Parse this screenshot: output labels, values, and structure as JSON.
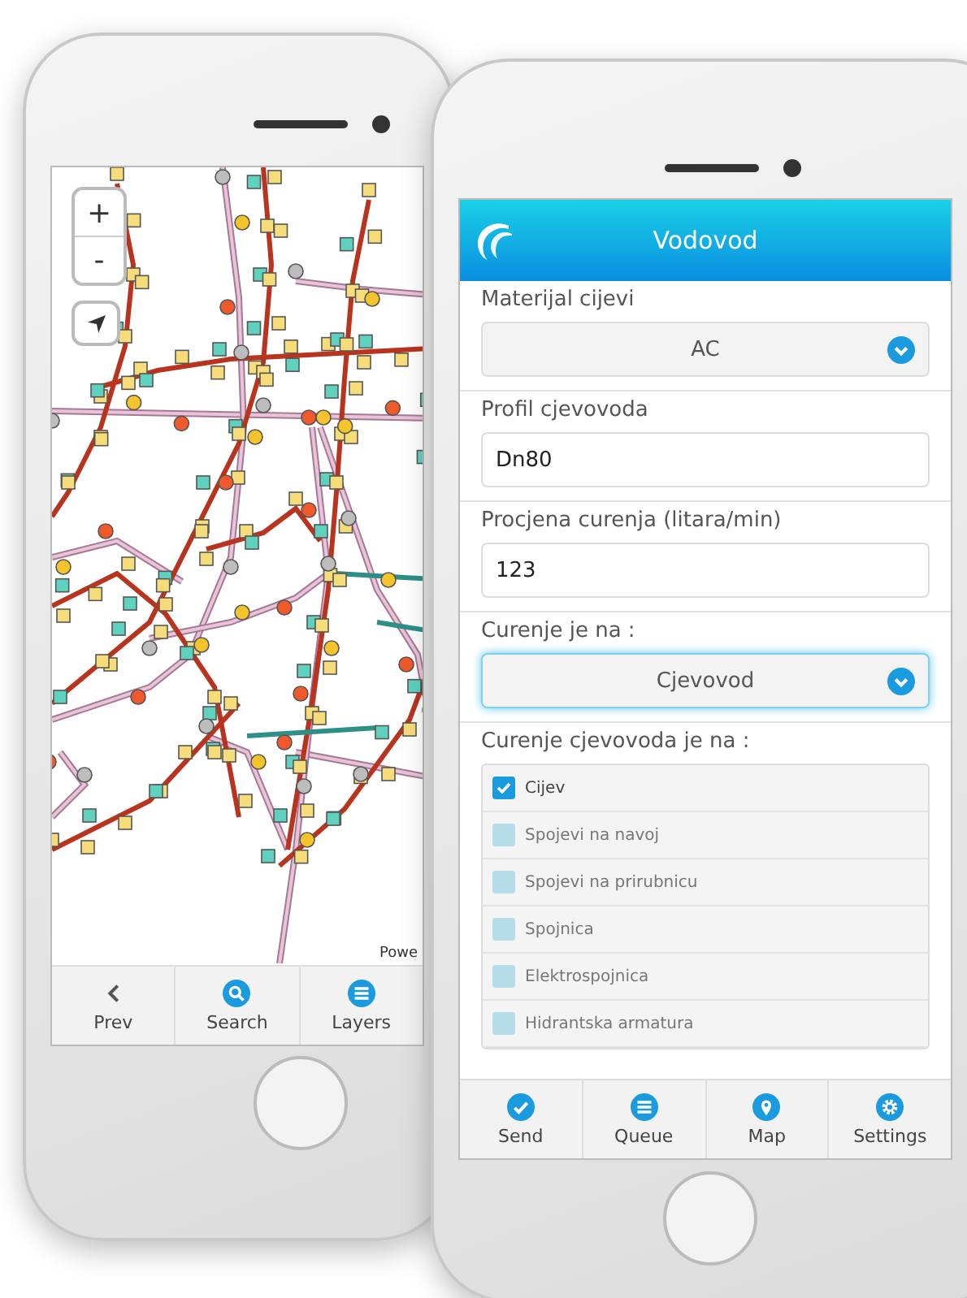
{
  "map_phone": {
    "zoom_in": "+",
    "zoom_out": "-",
    "attribution": "Powe",
    "toolbar": [
      {
        "label": "Prev",
        "kind": "chevron"
      },
      {
        "label": "Search",
        "kind": "search"
      },
      {
        "label": "Layers",
        "kind": "list"
      }
    ]
  },
  "form_phone": {
    "title": "Vodovod",
    "fields": [
      {
        "kind": "select",
        "label": "Materijal cijevi",
        "value": "AC",
        "focused": false
      },
      {
        "kind": "text",
        "label": "Profil cjevovoda",
        "value": "Dn80"
      },
      {
        "kind": "text",
        "label": "Procjena curenja (litara/min)",
        "value": "123"
      },
      {
        "kind": "select",
        "label": "Curenje je na :",
        "value": "Cjevovod",
        "focused": true
      }
    ],
    "checklist": {
      "label": "Curenje cjevovoda je na :",
      "items": [
        {
          "label": "Cijev",
          "checked": true
        },
        {
          "label": "Spojevi na navoj",
          "checked": false
        },
        {
          "label": "Spojevi na prirubnicu",
          "checked": false
        },
        {
          "label": "Spojnica",
          "checked": false
        },
        {
          "label": "Elektrospojnica",
          "checked": false
        },
        {
          "label": "Hidrantska armatura",
          "checked": false
        }
      ]
    },
    "tabs": [
      {
        "label": "Send",
        "kind": "check"
      },
      {
        "label": "Queue",
        "kind": "list"
      },
      {
        "label": "Map",
        "kind": "pin"
      },
      {
        "label": "Settings",
        "kind": "gear"
      }
    ]
  }
}
